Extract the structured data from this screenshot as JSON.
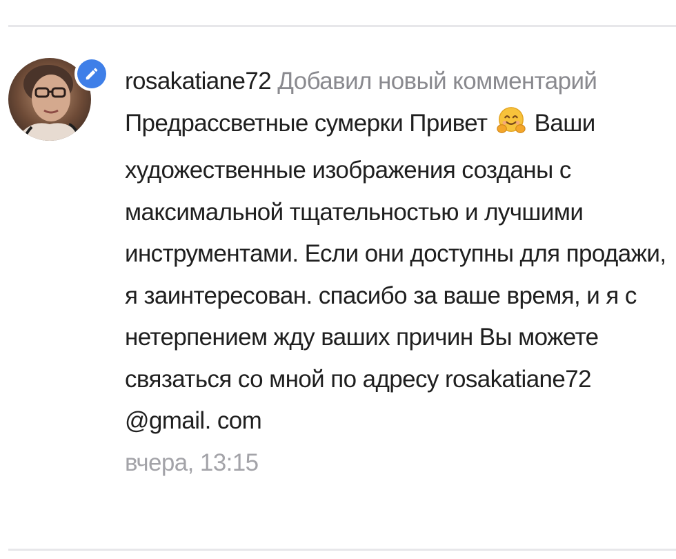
{
  "notification": {
    "username": "rosakatiane72",
    "action_text": "Добавил новый комментарий",
    "post_title": "Предрассветные сумерки",
    "greeting": "Привет",
    "emoji_icon": "hugging-face-emoji",
    "comment_body": "Ваши художественные изображения созданы с максимальной тщательностью и лучшими инструментами. Если они доступны для продажи, я заинтересован. спасибо за ваше время, и я с нетерпением жду ваших причин Вы можете связаться со мной по адресу rosakatiane72 @gmail. com",
    "timestamp": "вчера, 13:15",
    "badge_icon": "pencil-icon",
    "colors": {
      "badge": "#3f7fe8",
      "primary_text": "#1f1f1f",
      "secondary_text": "#8a8a8f",
      "timestamp_text": "#a3a3a8",
      "divider": "#e7e7ea"
    }
  }
}
